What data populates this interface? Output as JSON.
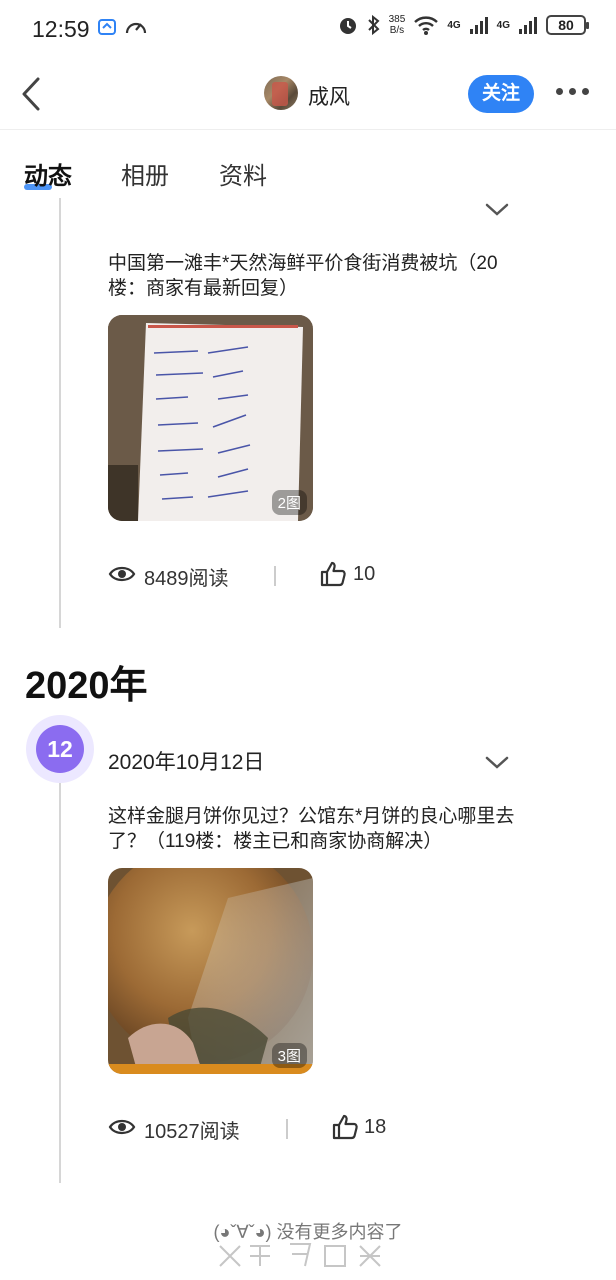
{
  "status_bar": {
    "time": "12:59",
    "speed_value": "385",
    "speed_unit": "B/s",
    "net1": "4G",
    "net2": "4G",
    "battery": "80"
  },
  "header": {
    "user_name": "成风",
    "follow_label": "关注"
  },
  "tabs": [
    "动态",
    "相册",
    "资料"
  ],
  "posts": [
    {
      "title": "中国第一滩丰*天然海鲜平价食街消费被坑（20楼：商家有最新回复）",
      "image_count": "2图",
      "reads": "8489阅读",
      "likes": "10"
    },
    {
      "day": "12",
      "date": "2020年10月12日",
      "title": "这样金腿月饼你见过？公馆东*月饼的良心哪里去了？（119楼：楼主已和商家协商解决）",
      "image_count": "3图",
      "reads": "10527阅读",
      "likes": "18"
    }
  ],
  "year_label": "2020年",
  "end_text": "(◕ˇ∀ˇ◕) 没有更多内容了",
  "colors": {
    "accent": "#2f83f5",
    "badge": "#8b6cf0"
  },
  "icons": [
    "back-icon",
    "more-icon",
    "chevron-down-icon",
    "eye-icon",
    "thumbs-up-icon"
  ]
}
